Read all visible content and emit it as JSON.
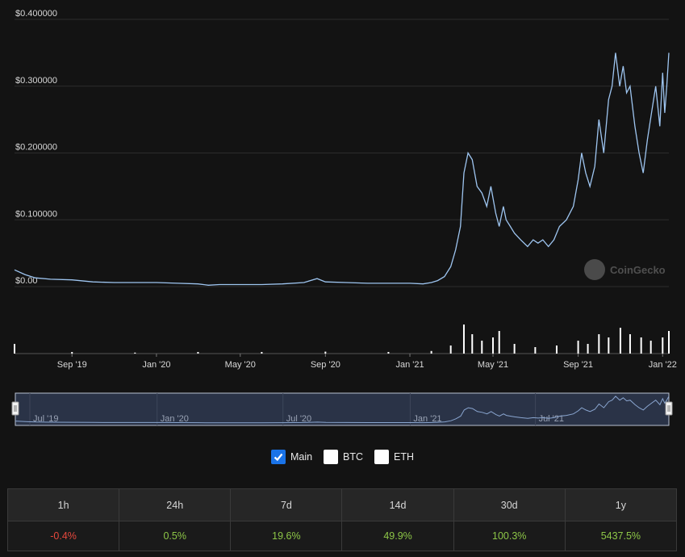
{
  "colors": {
    "background": "#131313",
    "line": "#9ec5f0",
    "volume": "#ffffff",
    "grid": "#2c2c2c",
    "checkbox_checked": "#1a73e8",
    "negative": "#e7483d",
    "positive": "#8dc647"
  },
  "chart_data": {
    "type": "line",
    "title": "",
    "xlabel": "",
    "ylabel": "",
    "y_tick_labels": [
      "$0.00",
      "$0.100000",
      "$0.200000",
      "$0.300000",
      "$0.400000"
    ],
    "ylim": [
      0,
      0.4
    ],
    "x_tick_labels": [
      "Sep '19",
      "Jan '20",
      "May '20",
      "Sep '20",
      "Jan '21",
      "May '21",
      "Sep '21",
      "Jan '22"
    ],
    "grid": true,
    "series": [
      {
        "x": [
          "2019-06-10",
          "2019-06-25",
          "2019-07-10",
          "2019-08-01",
          "2019-09-01",
          "2019-10-01",
          "2019-11-01",
          "2019-12-01",
          "2020-01-01",
          "2020-02-01",
          "2020-03-01",
          "2020-03-16",
          "2020-04-01",
          "2020-05-01",
          "2020-06-01",
          "2020-07-01",
          "2020-08-01",
          "2020-08-20",
          "2020-09-01",
          "2020-10-01",
          "2020-11-01",
          "2020-12-01",
          "2021-01-01",
          "2021-01-20",
          "2021-02-01",
          "2021-02-10",
          "2021-02-20",
          "2021-03-01",
          "2021-03-08",
          "2021-03-15",
          "2021-03-20",
          "2021-03-26",
          "2021-04-01",
          "2021-04-08",
          "2021-04-15",
          "2021-04-22",
          "2021-04-28",
          "2021-05-05",
          "2021-05-10",
          "2021-05-16",
          "2021-05-20",
          "2021-05-26",
          "2021-06-01",
          "2021-06-10",
          "2021-06-20",
          "2021-06-28",
          "2021-07-05",
          "2021-07-12",
          "2021-07-20",
          "2021-07-28",
          "2021-08-05",
          "2021-08-15",
          "2021-08-25",
          "2021-09-01",
          "2021-09-06",
          "2021-09-12",
          "2021-09-18",
          "2021-09-25",
          "2021-10-01",
          "2021-10-08",
          "2021-10-15",
          "2021-10-20",
          "2021-10-25",
          "2021-10-31",
          "2021-11-05",
          "2021-11-10",
          "2021-11-15",
          "2021-11-22",
          "2021-11-28",
          "2021-12-04",
          "2021-12-10",
          "2021-12-16",
          "2021-12-22",
          "2021-12-28",
          "2022-01-01",
          "2022-01-04",
          "2022-01-07",
          "2022-01-10"
        ],
        "values": [
          0.025,
          0.018,
          0.013,
          0.011,
          0.01,
          0.007,
          0.006,
          0.006,
          0.006,
          0.005,
          0.004,
          0.002,
          0.003,
          0.003,
          0.003,
          0.004,
          0.006,
          0.012,
          0.007,
          0.006,
          0.005,
          0.005,
          0.005,
          0.004,
          0.006,
          0.009,
          0.015,
          0.03,
          0.055,
          0.09,
          0.17,
          0.2,
          0.19,
          0.15,
          0.14,
          0.12,
          0.15,
          0.11,
          0.09,
          0.12,
          0.1,
          0.09,
          0.08,
          0.07,
          0.06,
          0.07,
          0.065,
          0.07,
          0.06,
          0.07,
          0.09,
          0.1,
          0.12,
          0.16,
          0.2,
          0.17,
          0.15,
          0.18,
          0.25,
          0.2,
          0.28,
          0.3,
          0.35,
          0.3,
          0.33,
          0.29,
          0.3,
          0.24,
          0.2,
          0.17,
          0.22,
          0.26,
          0.3,
          0.24,
          0.32,
          0.26,
          0.3,
          0.35
        ]
      }
    ],
    "volume": {
      "x": [
        "2019-06-10",
        "2019-09-01",
        "2019-12-01",
        "2020-03-01",
        "2020-06-01",
        "2020-09-01",
        "2020-12-01",
        "2021-02-01",
        "2021-03-01",
        "2021-03-20",
        "2021-04-01",
        "2021-04-15",
        "2021-05-01",
        "2021-05-10",
        "2021-06-01",
        "2021-07-01",
        "2021-08-01",
        "2021-09-01",
        "2021-09-15",
        "2021-10-01",
        "2021-10-15",
        "2021-11-01",
        "2021-11-15",
        "2021-12-01",
        "2021-12-15",
        "2022-01-01",
        "2022-01-10"
      ],
      "values": [
        0.3,
        0.05,
        0.03,
        0.05,
        0.05,
        0.06,
        0.05,
        0.08,
        0.25,
        0.9,
        0.6,
        0.4,
        0.5,
        0.7,
        0.3,
        0.2,
        0.25,
        0.4,
        0.3,
        0.6,
        0.5,
        0.8,
        0.6,
        0.5,
        0.4,
        0.5,
        0.7
      ]
    },
    "navigator": {
      "x_tick_labels": [
        "Jul '19",
        "Jan '20",
        "Jul '20",
        "Jan '21",
        "Jul '21"
      ]
    },
    "watermark": "CoinGecko"
  },
  "legend": {
    "items": [
      {
        "label": "Main",
        "checked": true
      },
      {
        "label": "BTC",
        "checked": false
      },
      {
        "label": "ETH",
        "checked": false
      }
    ]
  },
  "performance": {
    "headers": [
      "1h",
      "24h",
      "7d",
      "14d",
      "30d",
      "1y"
    ],
    "values": [
      "-0.4%",
      "0.5%",
      "19.6%",
      "49.9%",
      "100.3%",
      "5437.5%"
    ],
    "signs": [
      "neg",
      "pos",
      "pos",
      "pos",
      "pos",
      "pos"
    ]
  }
}
